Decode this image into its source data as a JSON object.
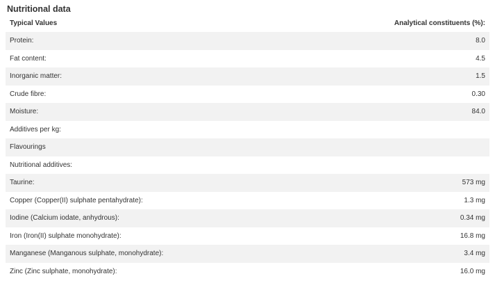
{
  "section": {
    "title": "Nutritional data"
  },
  "table": {
    "headers": [
      "Typical Values",
      "Analytical constituents (%):"
    ],
    "rows": [
      {
        "label": "Protein:",
        "value": "8.0"
      },
      {
        "label": "Fat content:",
        "value": "4.5"
      },
      {
        "label": "Inorganic matter:",
        "value": "1.5"
      },
      {
        "label": "Crude fibre:",
        "value": "0.30"
      },
      {
        "label": "Moisture:",
        "value": "84.0"
      },
      {
        "label": "Additives per kg:",
        "value": ""
      },
      {
        "label": "Flavourings",
        "value": ""
      },
      {
        "label": "Nutritional additives:",
        "value": ""
      },
      {
        "label": "Taurine:",
        "value": "573 mg"
      },
      {
        "label": "Copper (Copper(II) sulphate pentahydrate):",
        "value": "1.3 mg"
      },
      {
        "label": "Iodine (Calcium iodate, anhydrous):",
        "value": "0.34 mg"
      },
      {
        "label": "Iron (Iron(II) sulphate monohydrate):",
        "value": "16.8 mg"
      },
      {
        "label": "Manganese (Manganous sulphate, monohydrate):",
        "value": "3.4 mg"
      },
      {
        "label": "Zinc (Zinc sulphate, monohydrate):",
        "value": "16.0 mg"
      }
    ]
  },
  "colors": {
    "text": "#333333",
    "stripe": "#f2f2f2",
    "background": "#ffffff"
  }
}
